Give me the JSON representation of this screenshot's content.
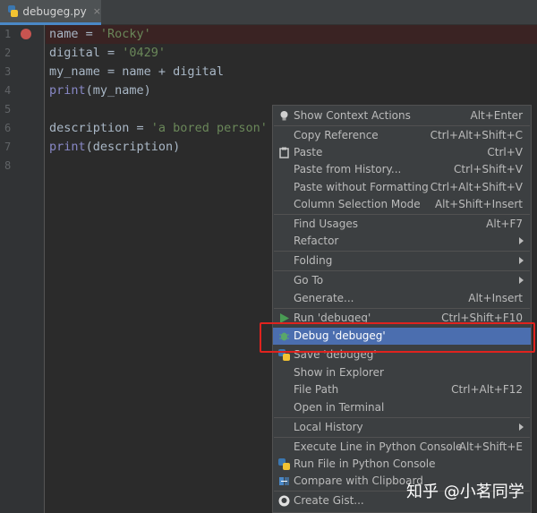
{
  "tab": {
    "filename": "debugeg.py",
    "close": "×"
  },
  "gutter": {
    "line_numbers": [
      "1",
      "2",
      "3",
      "4",
      "5",
      "6",
      "7",
      "8"
    ]
  },
  "code": {
    "l1": {
      "a": "name = ",
      "s": "'Rocky'"
    },
    "l2": {
      "a": "digital = ",
      "s": "'0429'"
    },
    "l3": {
      "a": "my_name = name + digital"
    },
    "l4": {
      "fn": "print",
      "rest": "(my_name)"
    },
    "l6": {
      "a": "description = ",
      "s": "'a bored person'"
    },
    "l7": {
      "fn": "print",
      "rest": "(description)"
    }
  },
  "menu": {
    "items": [
      {
        "label": "Show Context Actions",
        "shortcut": "Alt+Enter",
        "icon": "lightbulb-icon"
      },
      {
        "label": "Copy Reference",
        "shortcut": "Ctrl+Alt+Shift+C"
      },
      {
        "label": "Paste",
        "shortcut": "Ctrl+V",
        "icon": "clipboard-icon"
      },
      {
        "label": "Paste from History...",
        "shortcut": "Ctrl+Shift+V"
      },
      {
        "label": "Paste without Formatting",
        "shortcut": "Ctrl+Alt+Shift+V"
      },
      {
        "label": "Column Selection Mode",
        "shortcut": "Alt+Shift+Insert"
      },
      {
        "label": "Find Usages",
        "shortcut": "Alt+F7"
      },
      {
        "label": "Refactor",
        "submenu": true
      },
      {
        "label": "Folding",
        "submenu": true
      },
      {
        "label": "Go To",
        "submenu": true
      },
      {
        "label": "Generate...",
        "shortcut": "Alt+Insert"
      },
      {
        "label": "Run 'debugeg'",
        "shortcut": "Ctrl+Shift+F10",
        "icon": "run-icon"
      },
      {
        "label": "Debug 'debugeg'",
        "icon": "debug-icon"
      },
      {
        "label": "Save 'debugeg'",
        "icon": "python-icon"
      },
      {
        "label": "Show in Explorer"
      },
      {
        "label": "File Path",
        "shortcut": "Ctrl+Alt+F12"
      },
      {
        "label": "Open in Terminal"
      },
      {
        "label": "Local History",
        "submenu": true
      },
      {
        "label": "Execute Line in Python Console",
        "shortcut": "Alt+Shift+E"
      },
      {
        "label": "Run File in Python Console",
        "icon": "python-icon"
      },
      {
        "label": "Compare with Clipboard",
        "icon": "compare-icon"
      },
      {
        "label": "Create Gist...",
        "icon": "github-icon"
      }
    ]
  },
  "watermark": "知乎 @小茗同学",
  "colors": {
    "accent": "#4b6eaf",
    "highlight_border": "#e0231e",
    "string": "#6a8759",
    "builtin": "#8888c6"
  }
}
